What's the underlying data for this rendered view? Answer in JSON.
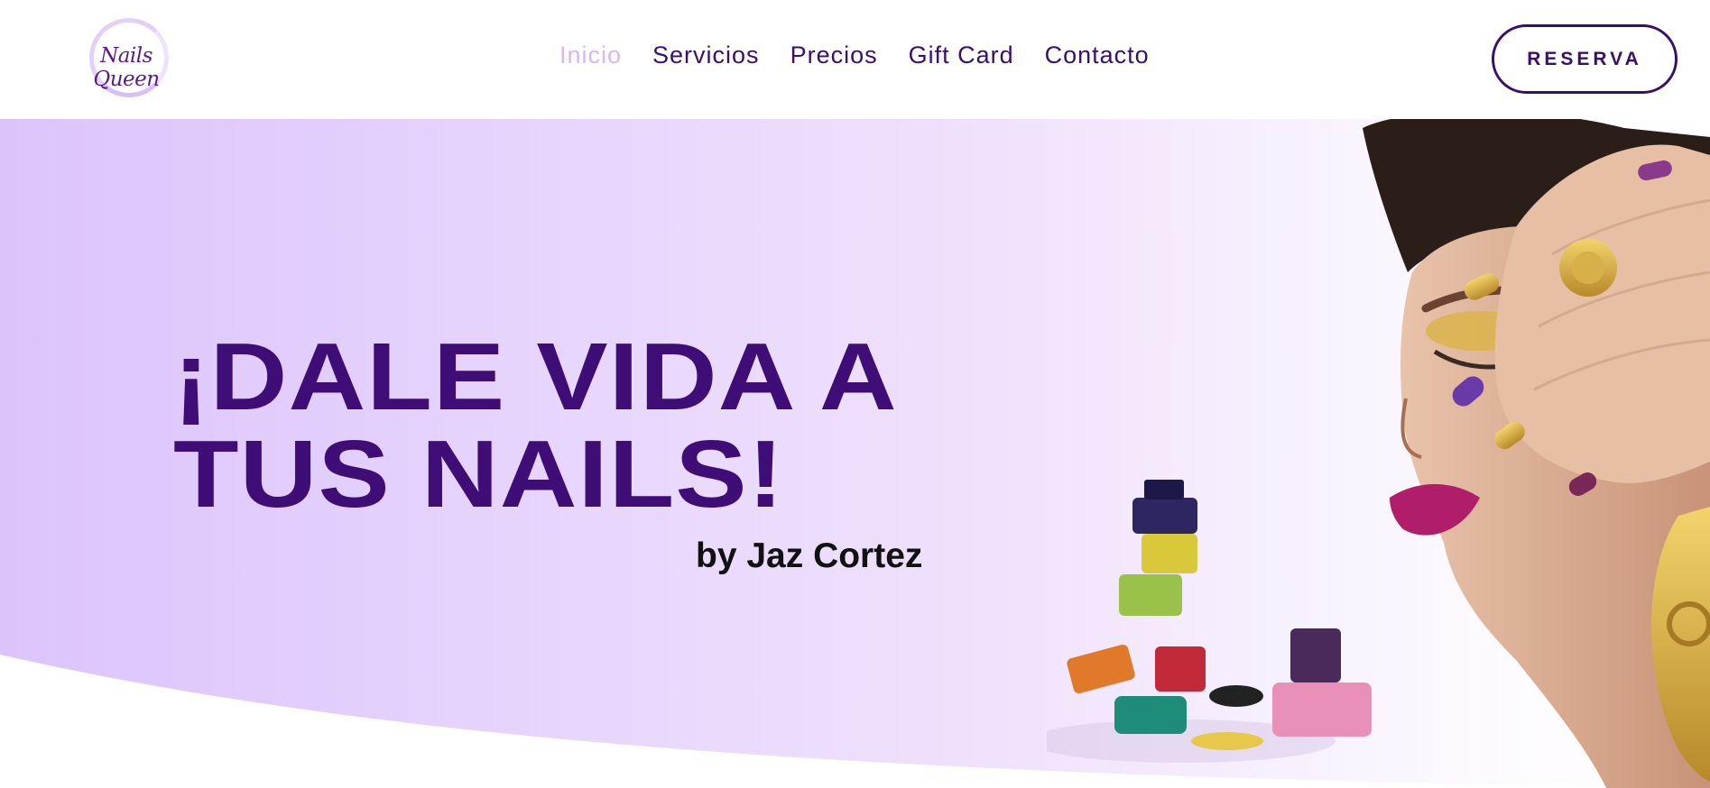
{
  "brand": {
    "logo_text": "Nails Queen",
    "accent_color": "#3e0e76",
    "active_nav_color": "#d8b8ee",
    "hero_gradient": [
      "#dcc4fb",
      "#ffffff"
    ]
  },
  "nav": {
    "items": [
      {
        "label": "Inicio",
        "active": true
      },
      {
        "label": "Servicios",
        "active": false
      },
      {
        "label": "Precios",
        "active": false
      },
      {
        "label": "Gift Card",
        "active": false
      },
      {
        "label": "Contacto",
        "active": false
      }
    ]
  },
  "header": {
    "reserve_label": "RESERVA"
  },
  "hero": {
    "headline_line1": "¡DALE VIDA A",
    "headline_line2": "TUS NAILS!",
    "byline": "by Jaz Cortez",
    "image_desc_icons": [
      "woman-with-painted-nails-image",
      "nail-polish-bottles-image"
    ]
  }
}
